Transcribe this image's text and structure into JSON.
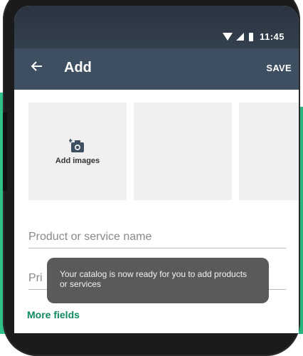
{
  "status_bar": {
    "time": "11:45",
    "icons": [
      "wifi-icon",
      "signal-icon",
      "battery-icon"
    ]
  },
  "app_bar": {
    "back_icon": "arrow-left-icon",
    "title": "Add",
    "save_label": "SAVE",
    "color": "#3d4f61"
  },
  "images": {
    "add_label": "Add images",
    "icon": "camera-add-icon",
    "slots": 3
  },
  "form": {
    "name_placeholder": "Product or service name",
    "price_placeholder": "Pri"
  },
  "more_fields_label": "More fields",
  "toast": {
    "message": "Your catalog is now ready for you to add products or services"
  },
  "colors": {
    "accent_green": "#0e8a5f",
    "background_green": "#2fc187"
  }
}
